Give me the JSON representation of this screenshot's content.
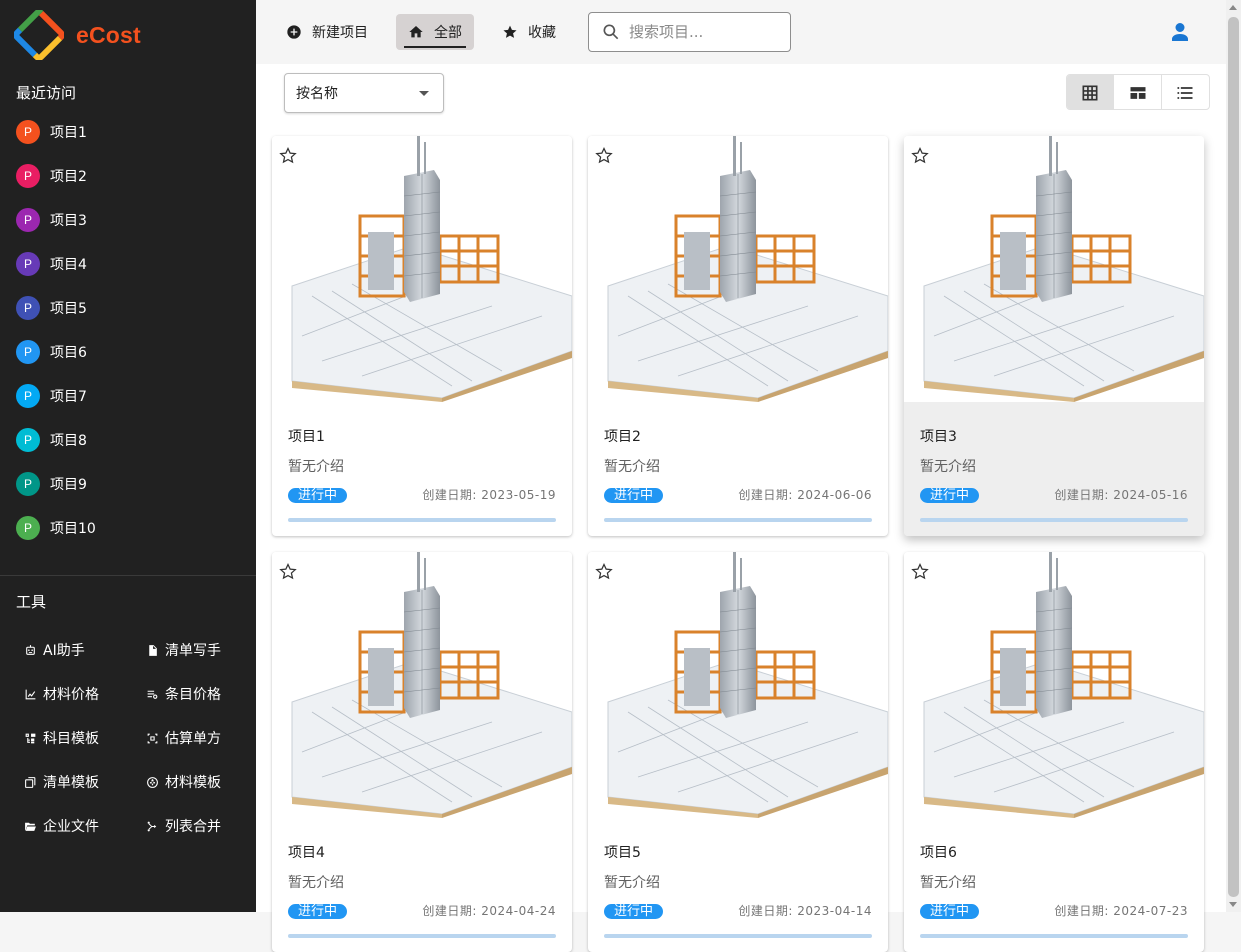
{
  "app": {
    "name": "eCost"
  },
  "sidebar": {
    "recent_title": "最近访问",
    "recent": [
      {
        "label": "项目1",
        "avatar": "P",
        "color": "#f4511e"
      },
      {
        "label": "项目2",
        "avatar": "P",
        "color": "#e91e63"
      },
      {
        "label": "项目3",
        "avatar": "P",
        "color": "#9c27b0"
      },
      {
        "label": "项目4",
        "avatar": "P",
        "color": "#673ab7"
      },
      {
        "label": "项目5",
        "avatar": "P",
        "color": "#3f51b5"
      },
      {
        "label": "项目6",
        "avatar": "P",
        "color": "#2196f3"
      },
      {
        "label": "项目7",
        "avatar": "P",
        "color": "#03a9f4"
      },
      {
        "label": "项目8",
        "avatar": "P",
        "color": "#00bcd4"
      },
      {
        "label": "项目9",
        "avatar": "P",
        "color": "#009688"
      },
      {
        "label": "项目10",
        "avatar": "P",
        "color": "#4caf50"
      }
    ],
    "tools_title": "工具",
    "tools": [
      {
        "label": "AI助手",
        "icon": "robot-icon"
      },
      {
        "label": "清单写手",
        "icon": "document-icon"
      },
      {
        "label": "材料价格",
        "icon": "chart-line-icon"
      },
      {
        "label": "条目价格",
        "icon": "list-price-icon"
      },
      {
        "label": "科目模板",
        "icon": "tree-icon"
      },
      {
        "label": "估算单方",
        "icon": "calculator-icon"
      },
      {
        "label": "清单模板",
        "icon": "copy-icon"
      },
      {
        "label": "材料模板",
        "icon": "aperture-icon"
      },
      {
        "label": "企业文件",
        "icon": "folder-open-icon"
      },
      {
        "label": "列表合并",
        "icon": "merge-icon"
      }
    ]
  },
  "toolbar": {
    "new_project": "新建项目",
    "all": "全部",
    "favorites": "收藏",
    "search_placeholder": "搜索项目..."
  },
  "main": {
    "sort_label": "按名称",
    "view_modes": [
      "grid-view-icon",
      "card-view-icon",
      "list-view-icon"
    ],
    "status_color": "#2196f3",
    "projects": [
      {
        "title": "项目1",
        "desc": "暂无介绍",
        "status": "进行中",
        "date": "创建日期: 2023-05-19",
        "starred": false
      },
      {
        "title": "项目2",
        "desc": "暂无介绍",
        "status": "进行中",
        "date": "创建日期: 2024-06-06",
        "starred": false
      },
      {
        "title": "项目3",
        "desc": "暂无介绍",
        "status": "进行中",
        "date": "创建日期: 2024-05-16",
        "starred": false
      },
      {
        "title": "项目4",
        "desc": "暂无介绍",
        "status": "进行中",
        "date": "创建日期: 2024-04-24",
        "starred": false
      },
      {
        "title": "项目5",
        "desc": "暂无介绍",
        "status": "进行中",
        "date": "创建日期: 2023-04-14",
        "starred": false
      },
      {
        "title": "项目6",
        "desc": "暂无介绍",
        "status": "进行中",
        "date": "创建日期: 2024-07-23",
        "starred": false
      }
    ]
  }
}
